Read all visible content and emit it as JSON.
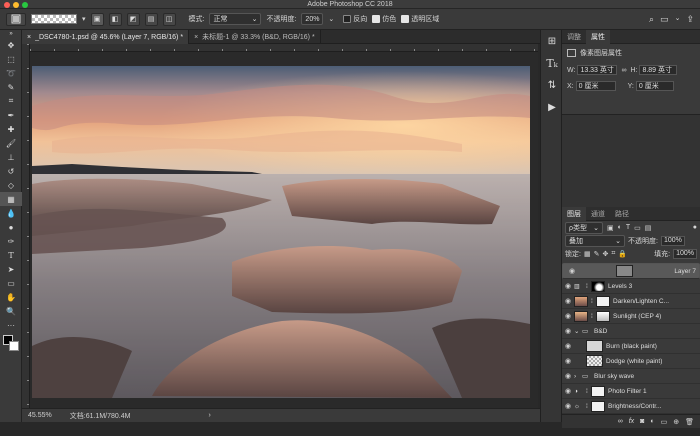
{
  "app": {
    "title": "Adobe Photoshop CC 2018"
  },
  "colors": {
    "close": "#fe5f57",
    "minimize": "#febc2e",
    "zoom": "#28c840",
    "accent": "#4a90e2"
  },
  "options": {
    "mode_label": "模式:",
    "mode_value": "正常",
    "opacity_label": "不透明度:",
    "opacity_value": "20%",
    "reverse_label": "反向",
    "dither_label": "仿色",
    "transparency_label": "透明区域"
  },
  "tabs": [
    {
      "label": "_DSC4780-1.psd @ 45.6% (Layer 7, RGB/16) *"
    },
    {
      "label": "未标题-1 @ 33.3% (B&D, RGB/16) *"
    }
  ],
  "status": {
    "zoom": "45.55%",
    "doc": "文档:61.1M/780.4M"
  },
  "properties": {
    "tab_adjust": "调整",
    "tab_props": "属性",
    "heading": "像素图层属性",
    "w_label": "W:",
    "w_value": "13.33 英寸",
    "h_label": "H:",
    "h_value": "8.89 英寸",
    "x_label": "X:",
    "x_value": "0 厘米",
    "y_label": "Y:",
    "y_value": "0 厘米"
  },
  "layers_panel": {
    "tab_layers": "图层",
    "tab_channels": "通道",
    "tab_paths": "路径",
    "filter_kind": "ρ类型",
    "blend_mode": "叠加",
    "opacity_label": "不透明度:",
    "opacity_value": "100%",
    "lock_label": "锁定:",
    "fill_label": "填充:",
    "fill_value": "100%",
    "layers": [
      {
        "name": "Layer 7",
        "type": "pixel",
        "selected": true
      },
      {
        "name": "Levels 3",
        "type": "adjust"
      },
      {
        "name": "Darken/Lighten C...",
        "type": "photo"
      },
      {
        "name": "Sunlight (CEP 4)",
        "type": "photo"
      },
      {
        "name": "B&D",
        "type": "group",
        "open": true
      },
      {
        "name": "Burn (black paint)",
        "type": "pixel",
        "indent": true
      },
      {
        "name": "Dodge (white paint)",
        "type": "pattern",
        "indent": true
      },
      {
        "name": "Blur sky wave",
        "type": "group"
      },
      {
        "name": "Photo Filter 1",
        "type": "adjust"
      },
      {
        "name": "Brightness/Contr...",
        "type": "adjust"
      }
    ]
  }
}
